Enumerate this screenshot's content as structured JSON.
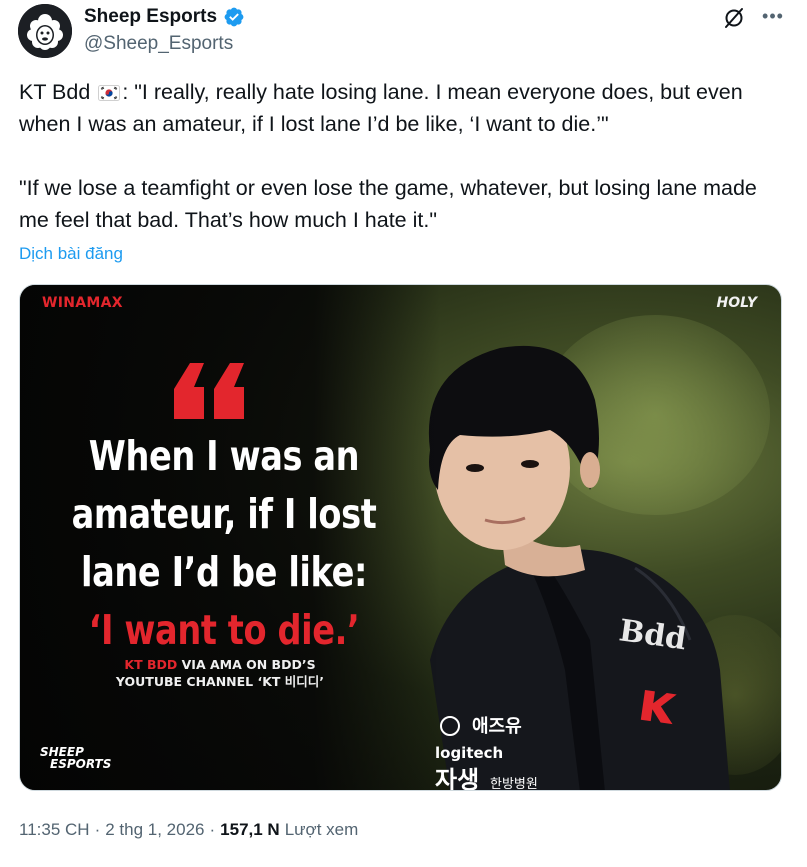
{
  "author": {
    "display_name": "Sheep Esports",
    "handle": "@Sheep_Esports",
    "verified": true,
    "avatar_icon": "sheep-icon"
  },
  "tweet": {
    "name_prefix": "KT Bdd",
    "flag": "south-korea-flag-icon",
    "paragraph1_after_flag": ": \"I really, really hate losing lane. I mean everyone does, but even when I was an amateur, if I lost lane I’d be like, ‘I want to die.’\"",
    "paragraph2": "\"If we lose a teamfight or even lose the game, whatever, but losing lane made me feel that bad. That’s how much I hate it.\"",
    "translate_label": "Dịch bài đăng"
  },
  "media": {
    "brand_left": "WINAMAX",
    "brand_right": "HOLY",
    "headline": {
      "line1": "When I was an",
      "line2": "amateur, if I lost",
      "line3": "lane I’d be like:",
      "line4": "‘I want to die.’"
    },
    "credit_red": "KT BDD",
    "credit_rest1": " VIA AMA ON BDD’S",
    "credit_line2": "YOUTUBE CHANNEL ‘KT 비디디’",
    "logo_line1": "SHEEP",
    "logo_line2": "ESPORTS",
    "jersey_name": "Bdd",
    "sponsor1": "애즈유",
    "sponsor2": "logitech",
    "sponsor3": "자생",
    "sponsor3_sub": "한방병원",
    "colors": {
      "accent_red": "#e3262d"
    }
  },
  "meta": {
    "time": "11:35 CH",
    "separator": "·",
    "date": "2 thg 1, 2026",
    "views_count": "157,1 N",
    "views_label": "Lượt xem"
  },
  "colors": {
    "text_primary": "#0f1419",
    "text_secondary": "#536471",
    "link": "#1d9bf0",
    "verified": "#1d9bf0"
  }
}
